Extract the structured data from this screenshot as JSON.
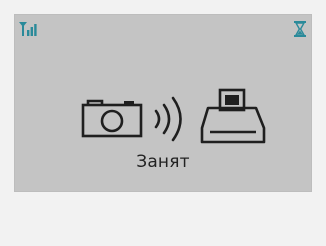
{
  "screen": {
    "status_text": "Занят",
    "icons": {
      "signal": "signal-strength-icon",
      "busy": "hourglass-icon",
      "camera": "camera-icon",
      "transfer": "wireless-waves-icon",
      "printer": "printer-icon"
    }
  },
  "colors": {
    "screen_bg": "#c4c4c4",
    "page_bg": "#f2f2f2",
    "accent_teal": "#2a8a9a",
    "icon_dark": "#1f1f1f"
  }
}
